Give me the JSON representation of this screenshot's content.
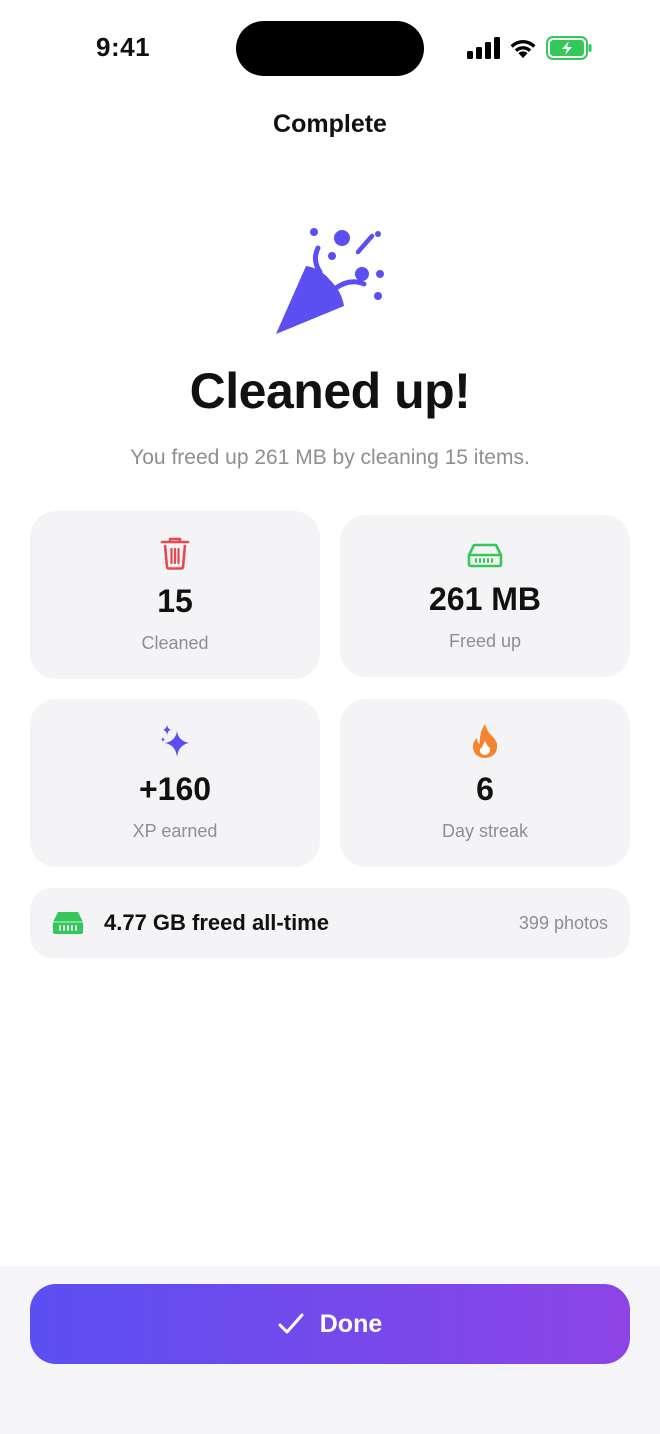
{
  "status": {
    "time": "9:41"
  },
  "nav": {
    "title": "Complete"
  },
  "hero": {
    "headline": "Cleaned up!",
    "subtitle": "You freed up 261 MB by cleaning 15 items."
  },
  "stats": [
    {
      "value": "15",
      "label": "Cleaned",
      "icon": "trash-icon",
      "color": "#e5484d"
    },
    {
      "value": "261 MB",
      "label": "Freed up",
      "icon": "storage-icon",
      "color": "#34c759"
    },
    {
      "value": "+160",
      "label": "XP earned",
      "icon": "sparkles-icon",
      "color": "#5b4ff2"
    },
    {
      "value": "6",
      "label": "Day streak",
      "icon": "flame-icon",
      "color": "#f7832c"
    }
  ],
  "alltime": {
    "text": "4.77 GB freed all-time",
    "photos": "399 photos",
    "icon": "storage-icon",
    "color": "#34c759"
  },
  "footer": {
    "done_label": "Done",
    "gradient_start": "#5b4ff2",
    "gradient_end": "#8d44e6"
  }
}
